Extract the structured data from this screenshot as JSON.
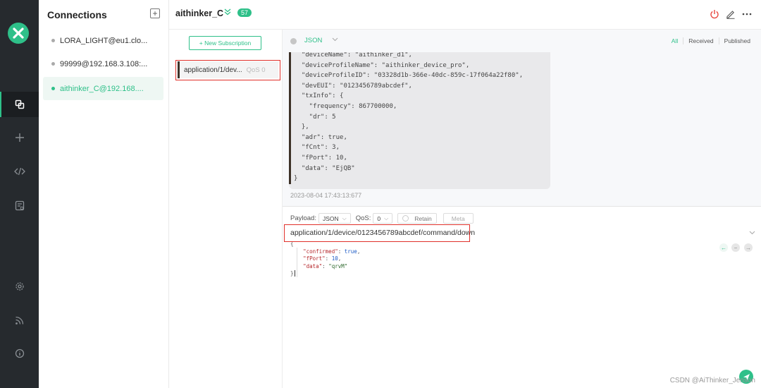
{
  "rail": {
    "icons": [
      "logo-icon",
      "connections-icon",
      "new-connection-icon",
      "script-icon",
      "log-icon",
      "settings-icon",
      "rss-icon",
      "about-icon"
    ]
  },
  "connections": {
    "title": "Connections",
    "add_icon": "+",
    "items": [
      {
        "label": "LORA_LIGHT@eu1.clo..."
      },
      {
        "label": "99999@192.168.3.108:..."
      },
      {
        "label": "aithinker_C@192.168...."
      }
    ]
  },
  "header": {
    "title": "aithinker_C",
    "count": "57"
  },
  "subscriptions": {
    "new_label": "+ New Subscription",
    "items": [
      {
        "topic": "application/1/dev...",
        "qos": "QoS 0"
      }
    ]
  },
  "messages": {
    "format": "JSON",
    "filters": [
      "All",
      "Received",
      "Published"
    ],
    "active_filter": "All",
    "body": "  \"deviceName\": \"aithinker_d1\",\n  \"deviceProfileName\": \"aithinker_device_pro\",\n  \"deviceProfileID\": \"03328d1b-366e-40dc-859c-17f064a22f80\",\n  \"devEUI\": \"0123456789abcdef\",\n  \"txInfo\": {\n    \"frequency\": 867700000,\n    \"dr\": 5\n  },\n  \"adr\": true,\n  \"fCnt\": 3,\n  \"fPort\": 10,\n  \"data\": \"EjQB\"\n}",
    "time": "2023-08-04 17:43:13:677"
  },
  "publish": {
    "payload_label": "Payload:",
    "payload_format": "JSON",
    "qos_label": "QoS:",
    "qos_value": "0",
    "retain_label": "Retain",
    "meta_label": "Meta",
    "topic": "application/1/device/0123456789abcdef/command/down",
    "payload": {
      "open": "{",
      "k1": "\"confirmed\"",
      "v1": "true",
      "k2": "\"fPort\"",
      "v2": "10",
      "k3": "\"data\"",
      "v3": "\"qrvM\"",
      "close": "}"
    }
  },
  "colors": {
    "accent": "#2ec089",
    "rail_bg": "#262a2e",
    "highlight_box": "#e0302a"
  },
  "watermark": "CSDN @AiThinker_Jenson"
}
